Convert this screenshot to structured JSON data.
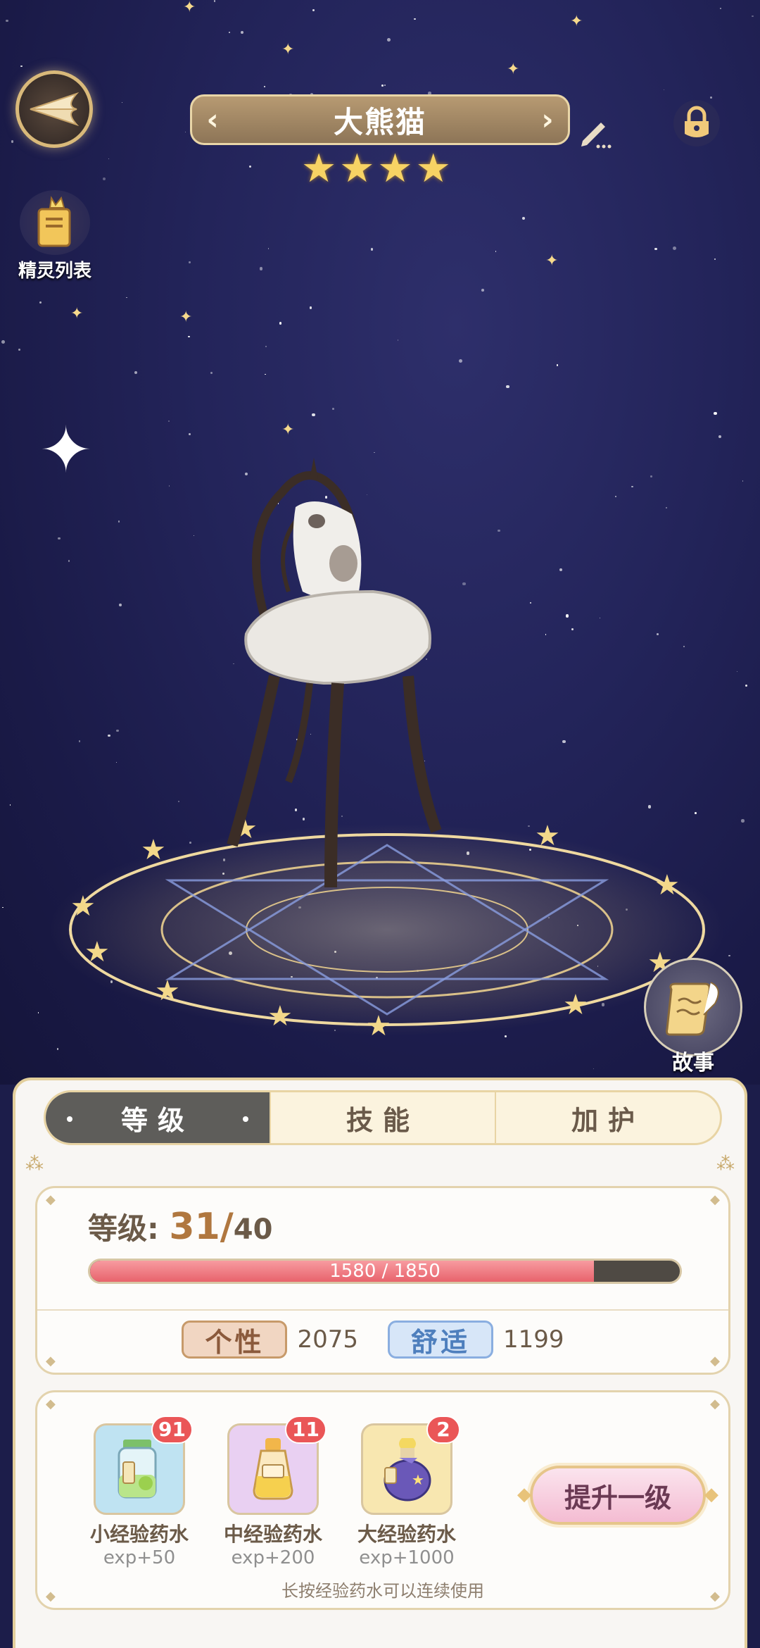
{
  "header": {
    "pet_name": "大熊猫",
    "star_count": 4,
    "sprite_list_label": "精灵列表",
    "story_label": "故事"
  },
  "tabs": [
    {
      "label": "等级",
      "active": true
    },
    {
      "label": "技能",
      "active": false
    },
    {
      "label": "加护",
      "active": false
    }
  ],
  "level": {
    "label": "等级:",
    "current": "31",
    "separator": "/",
    "max": "40",
    "exp_current": 1580,
    "exp_max": 1850,
    "exp_text": "1580 / 1850"
  },
  "stats": {
    "personality_label": "个性",
    "personality_value": "2075",
    "comfort_label": "舒适",
    "comfort_value": "1199"
  },
  "potions": [
    {
      "name": "小经验药水",
      "exp": "exp+50",
      "count": "91",
      "color": "#bfe3f2"
    },
    {
      "name": "中经验药水",
      "exp": "exp+200",
      "count": "11",
      "color": "#e9d0f2"
    },
    {
      "name": "大经验药水",
      "exp": "exp+1000",
      "count": "2",
      "color": "#f8e7b0"
    }
  ],
  "upgrade_button": "提升一级",
  "hint": "长按经验药水可以连续使用",
  "colors": {
    "gold": "#d9b97a",
    "exp_fill": "#e8636c",
    "badge": "#ea5657",
    "tab_active": "#5e5d5a"
  }
}
